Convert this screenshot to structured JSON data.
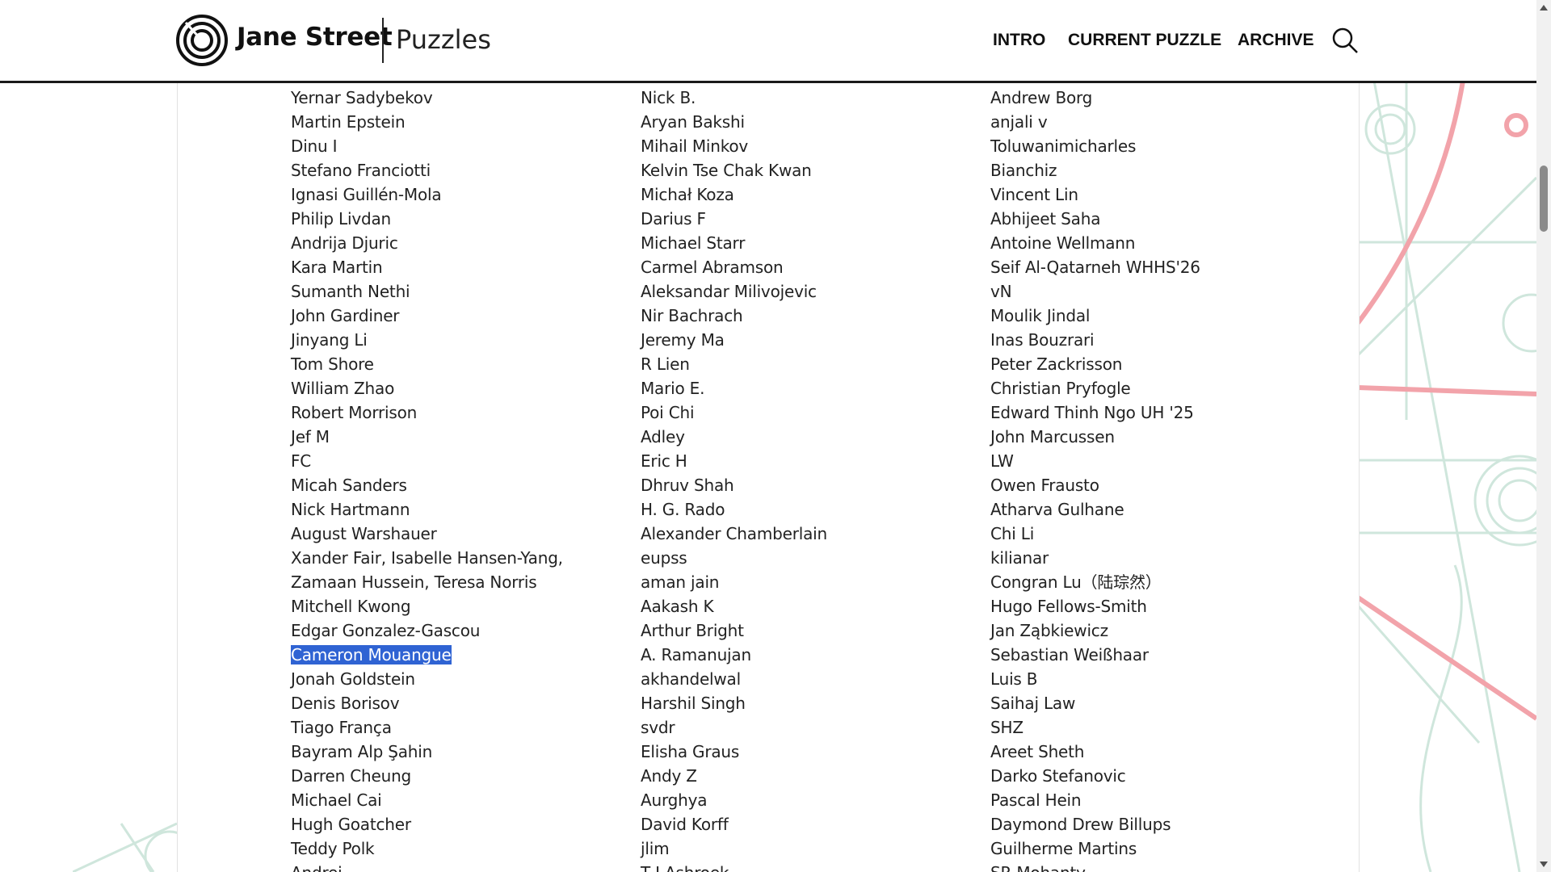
{
  "header": {
    "brand": "Jane Street",
    "section": "Puzzles",
    "nav": [
      "INTRO",
      "CURRENT PUZZLE",
      "ARCHIVE"
    ]
  },
  "colors": {
    "accent": "#2f63d3",
    "deco_pink": "#f2a3aa",
    "deco_green": "#cfe6dc"
  },
  "solvers": {
    "column_1": [
      "Yernar Sadybekov",
      "Martin Epstein",
      "Dinu I",
      "Stefano Franciotti",
      "Ignasi Guillén-Mola",
      "Philip Livdan",
      "Andrija Djuric",
      "Kara Martin",
      "Sumanth Nethi",
      "John Gardiner",
      "Jinyang Li",
      "Tom Shore",
      "William Zhao",
      "Robert Morrison",
      "Jef M",
      "FC",
      "Micah Sanders",
      "Nick Hartmann",
      "August Warshauer",
      "Xander Fair, Isabelle Hansen-Yang,",
      "Zamaan Hussein, Teresa Norris",
      "Mitchell Kwong",
      "Edgar Gonzalez-Gascou",
      "Cameron Mouangue",
      "Jonah Goldstein",
      "Denis Borisov",
      "Tiago França",
      "Bayram Alp Şahin",
      "Darren Cheung",
      "Michael Cai",
      "Hugh Goatcher",
      "Teddy Polk",
      "Andrej"
    ],
    "column_2": [
      "Nick B.",
      "Aryan Bakshi",
      "Mihail Minkov",
      "Kelvin Tse Chak Kwan",
      "Michał Koza",
      "Darius F",
      "Michael Starr",
      "Carmel Abramson",
      "Aleksandar Milivojevic",
      "Nir Bachrach",
      "Jeremy Ma",
      "R Lien",
      "Mario E.",
      "Poi Chi",
      "Adley",
      "Eric H",
      "Dhruv Shah",
      "H. G. Rado",
      "Alexander Chamberlain",
      "eupss",
      "aman jain",
      "Aakash K",
      "Arthur Bright",
      "A. Ramanujan",
      "akhandelwal",
      "Harshil Singh",
      "svdr",
      "Elisha Graus",
      "Andy Z",
      "Aurghya",
      "David Korff",
      "jlim",
      "T J Ashroek"
    ],
    "column_3": [
      "Andrew Borg",
      "anjali v",
      "Toluwanimicharles",
      "Bianchiz",
      "Vincent Lin",
      "Abhijeet Saha",
      "Antoine Wellmann",
      "Seif Al-Qatarneh WHHS'26",
      "vN",
      "Moulik Jindal",
      "Inas Bouzrari",
      "Peter Zackrisson",
      "Christian Pryfogle",
      "Edward Thinh Ngo UH '25",
      "John Marcussen",
      "LW",
      "Owen Frausto",
      "Atharva Gulhane",
      "Chi Li",
      "kilianar",
      "Congran Lu（陆琮然）",
      "Hugo Fellows-Smith",
      "Jan Ząbkiewicz",
      "Sebastian Weißhaar",
      "Luis B",
      "Saihaj Law",
      "SHZ",
      "Areet Sheth",
      "Darko Stefanovic",
      "Pascal Hein",
      "Daymond Drew Billups",
      "Guilherme Martins",
      "SR Mohanty"
    ],
    "selected": "Cameron Mouangue"
  }
}
